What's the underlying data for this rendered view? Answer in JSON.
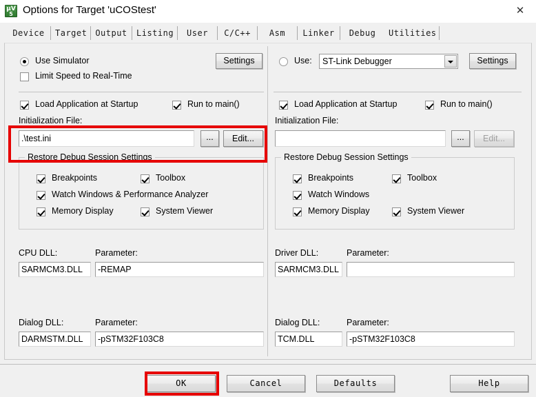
{
  "window": {
    "title": "Options for Target 'uCOStest'",
    "icon": "uvision-logo-icon",
    "close_label": "✕"
  },
  "tabs": [
    {
      "label": "Device",
      "selected": false
    },
    {
      "label": "Target",
      "selected": false
    },
    {
      "label": "Output",
      "selected": false
    },
    {
      "label": "Listing",
      "selected": false
    },
    {
      "label": "User",
      "selected": false
    },
    {
      "label": "C/C++",
      "selected": false
    },
    {
      "label": "Asm",
      "selected": false
    },
    {
      "label": "Linker",
      "selected": false
    },
    {
      "label": "Debug",
      "selected": true
    },
    {
      "label": "Utilities",
      "selected": false
    }
  ],
  "left_pane": {
    "use_simulator": {
      "label": "Use Simulator",
      "checked": true
    },
    "limit_speed": {
      "label": "Limit Speed to Real-Time",
      "checked": false
    },
    "settings_button": "Settings",
    "load_application": {
      "label": "Load Application at Startup",
      "checked": true
    },
    "run_to_main": {
      "label": "Run to main()",
      "checked": true
    },
    "init_file_label": "Initialization File:",
    "init_file_value": ".\\test.ini",
    "browse_button": "...",
    "edit_button": "Edit...",
    "edit_enabled": true,
    "restore_group_title": "Restore Debug Session Settings",
    "restore_items": [
      {
        "label": "Breakpoints",
        "checked": true
      },
      {
        "label": "Toolbox",
        "checked": true
      },
      {
        "label": "Watch Windows & Performance Analyzer",
        "checked": true
      },
      {
        "label": "Memory Display",
        "checked": true
      },
      {
        "label": "System Viewer",
        "checked": true
      }
    ],
    "cpu_dll_label": "CPU DLL:",
    "cpu_dll_value": "SARMCM3.DLL",
    "cpu_param_label": "Parameter:",
    "cpu_param_value": "-REMAP",
    "dialog_dll_label": "Dialog DLL:",
    "dialog_dll_value": "DARMSTM.DLL",
    "dialog_param_label": "Parameter:",
    "dialog_param_value": "-pSTM32F103C8"
  },
  "right_pane": {
    "use_radio": {
      "label": "Use:",
      "checked": false
    },
    "debugger_selected": "ST-Link Debugger",
    "settings_button": "Settings",
    "load_application": {
      "label": "Load Application at Startup",
      "checked": true
    },
    "run_to_main": {
      "label": "Run to main()",
      "checked": true
    },
    "init_file_label": "Initialization File:",
    "init_file_value": "",
    "browse_button": "...",
    "edit_button": "Edit...",
    "edit_enabled": false,
    "restore_group_title": "Restore Debug Session Settings",
    "restore_items": [
      {
        "label": "Breakpoints",
        "checked": true
      },
      {
        "label": "Toolbox",
        "checked": true
      },
      {
        "label": "Watch Windows",
        "checked": true
      },
      {
        "label": "Memory Display",
        "checked": true
      },
      {
        "label": "System Viewer",
        "checked": true
      }
    ],
    "driver_dll_label": "Driver DLL:",
    "driver_dll_value": "SARMCM3.DLL",
    "driver_param_label": "Parameter:",
    "driver_param_value": "",
    "dialog_dll_label": "Dialog DLL:",
    "dialog_dll_value": "TCM.DLL",
    "dialog_param_label": "Parameter:",
    "dialog_param_value": "-pSTM32F103C8"
  },
  "footer": {
    "ok": "OK",
    "cancel": "Cancel",
    "defaults": "Defaults",
    "help": "Help"
  },
  "annotations": {
    "color": "#e60000",
    "targets": [
      "debug-tab",
      "initialization-file-row",
      "ok-button"
    ]
  }
}
